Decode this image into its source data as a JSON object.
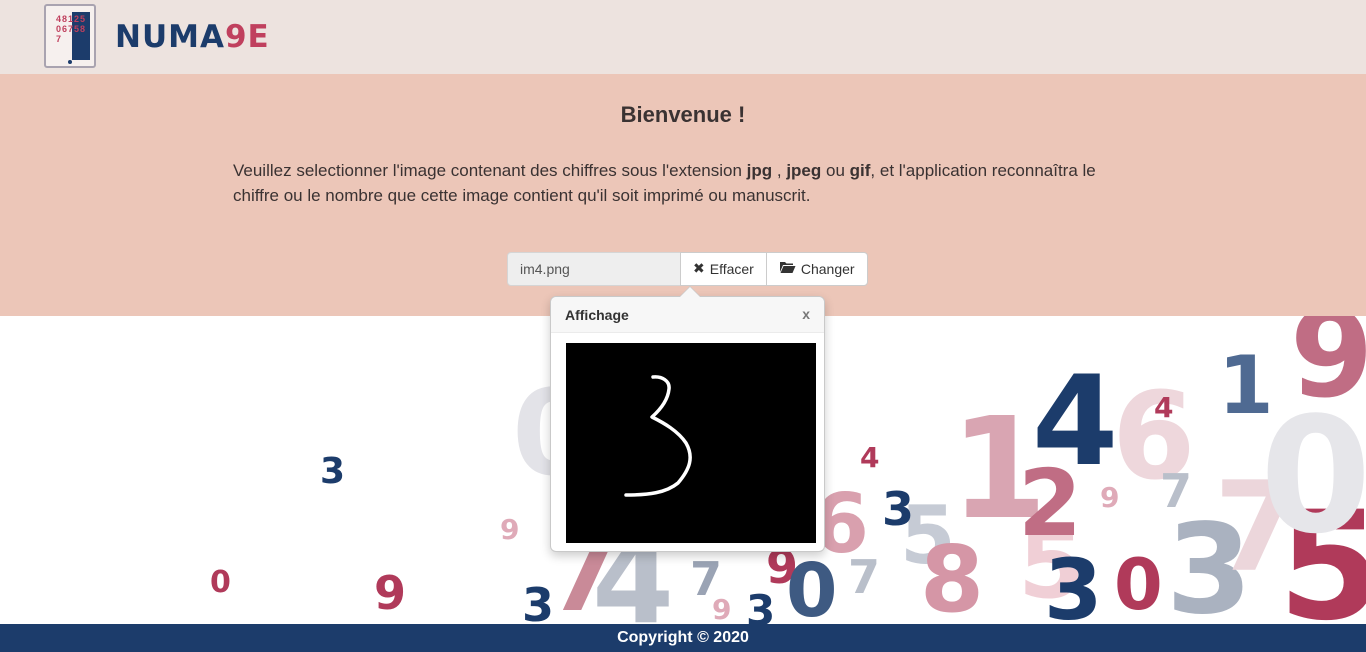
{
  "logo": {
    "icon_digits": "48125067587",
    "brand_prefix": "NUMA",
    "brand_suffix": "9E"
  },
  "hero": {
    "title": "Bienvenue !",
    "text_1": "Veuillez selectionner l'image contenant des chiffres sous l'extension ",
    "ext_jpg": "jpg",
    "sep_1": " , ",
    "ext_jpeg": "jpeg",
    "sep_2": " ou ",
    "ext_gif": "gif",
    "text_2": ", et l'application reconnaîtra le chiffre ou le nombre que cette image contient qu'il soit imprimé ou manuscrit."
  },
  "upload": {
    "file_name": "im4.png",
    "clear_label": "Effacer",
    "change_label": "Changer",
    "clear_icon": "times-icon",
    "change_icon": "folder-open-icon"
  },
  "popover": {
    "title": "Affichage",
    "close_label": "x",
    "preview_alt": "handwritten digit 3"
  },
  "background_digits": [
    "0",
    "3",
    "9",
    "0",
    "9",
    "3",
    "7",
    "4",
    "7",
    "9",
    "3",
    "9",
    "6",
    "5",
    "7",
    "0",
    "8",
    "4",
    "3",
    "5",
    "1",
    "2",
    "4",
    "6",
    "4",
    "9",
    "1",
    "7",
    "3",
    "0",
    "3",
    "5",
    "7",
    "0",
    "9",
    "9"
  ],
  "footer": {
    "copyright": "Copyright © 2020"
  },
  "colors": {
    "header_bg": "#ede3df",
    "hero_bg": "#ecc6b8",
    "navy": "#1c3c6b",
    "crimson": "#c0405e",
    "footer_bg": "#1c3c6b"
  }
}
